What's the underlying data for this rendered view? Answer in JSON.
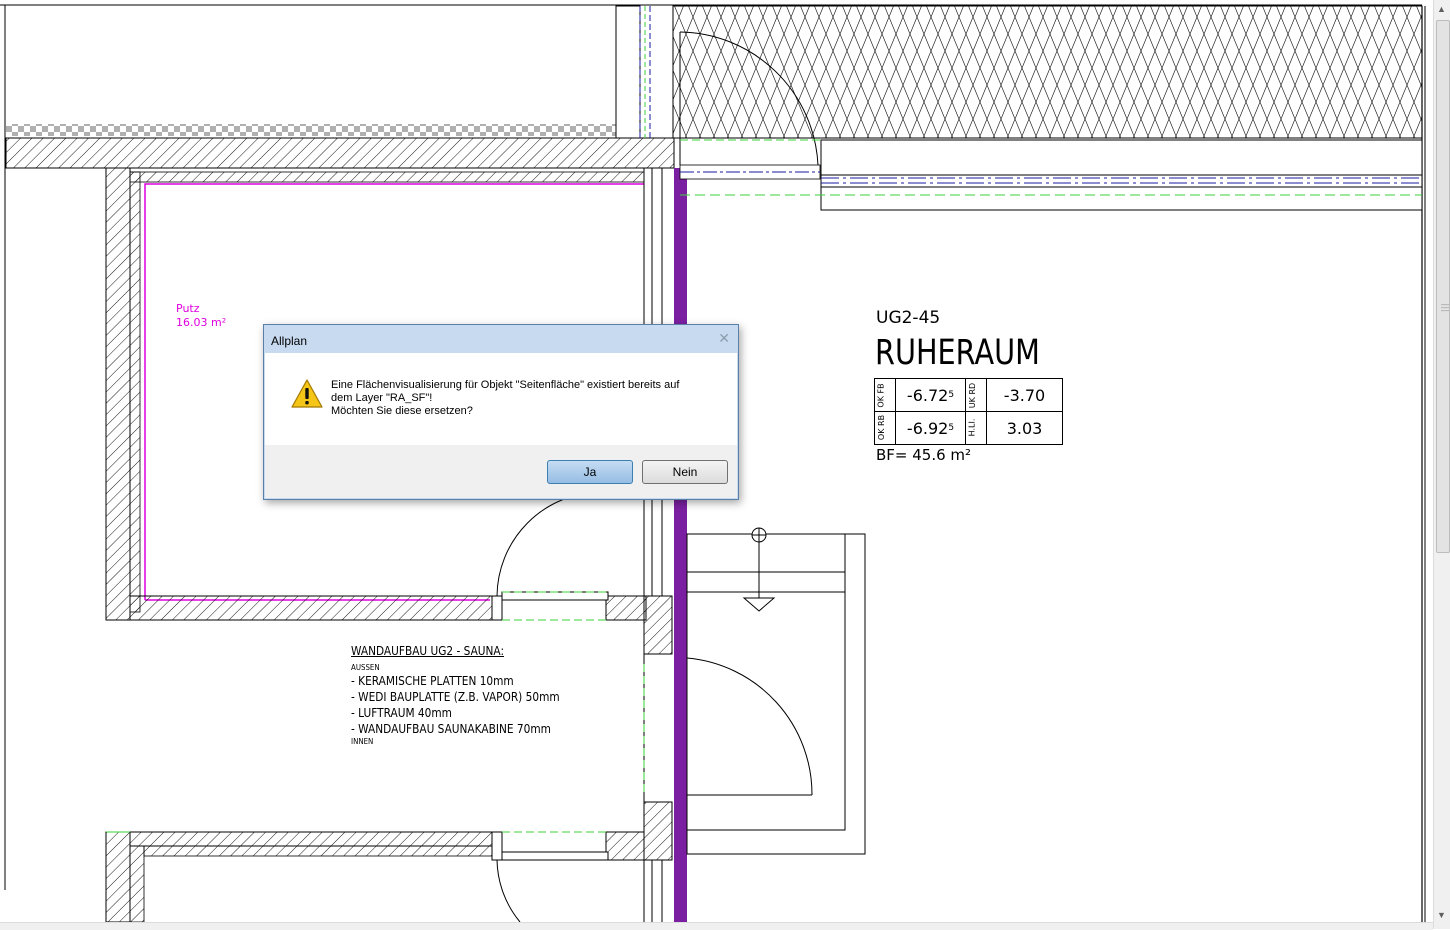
{
  "dialog": {
    "title": "Allplan",
    "close_glyph": "✕",
    "message_line1": "Eine Flächenvisualisierung für Objekt \"Seitenfläche\" existiert bereits auf",
    "message_line2": "dem Layer \"RA_SF\"!",
    "message_line3": "Möchten Sie diese ersetzen?",
    "icon": "warning-icon",
    "yes_label": "Ja",
    "no_label": "Nein"
  },
  "plan": {
    "putz_label": "Putz",
    "putz_area": "16.03 m²",
    "room_id": "UG2-45",
    "room_name": "RUHERAUM",
    "level_table": {
      "ok_fb_label": "OK FB",
      "ok_fb_value": "-6.72",
      "ok_fb_sup": "5",
      "uk_rd_label": "UK RD",
      "uk_rd_value": "-3.70",
      "ok_rb_label": "OK RB",
      "ok_rb_value": "-6.92",
      "ok_rb_sup": "5",
      "h_li_label": "H.LI.",
      "h_li_value": "3.03"
    },
    "bf": "BF= 45.6 m²",
    "notes": {
      "heading": "WANDAUFBAU UG2 - SAUNA:",
      "outside": "AUSSEN",
      "lines": [
        "- KERAMISCHE PLATTEN 10mm",
        "- WEDI BAUPLATTE (Z.B. VAPOR) 50mm",
        "- LUFTRAUM 40mm",
        "- WANDAUFBAU SAUNAKABINE 70mm"
      ],
      "inside": "INNEN"
    }
  },
  "colors": {
    "purple_wall": "#7b1fa2",
    "magenta_line": "#e000e0",
    "green_dash": "#3cd23c",
    "blue_dash": "#1a1aa0",
    "dialog_frame": "#c8daf0",
    "accent_button": "#96bde4"
  }
}
